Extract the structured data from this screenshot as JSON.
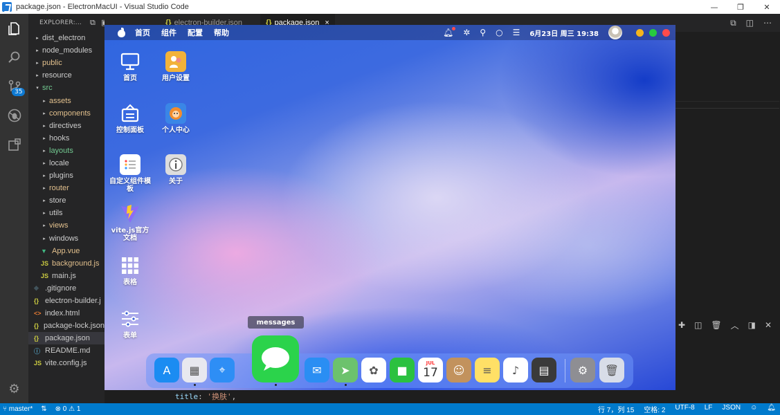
{
  "window": {
    "title": "package.json - ElectronMacUI - Visual Studio Code",
    "controls": [
      "—",
      "❐",
      "✕"
    ]
  },
  "activity": {
    "scm_badge": "35"
  },
  "explorer": {
    "header": "EXPLORER:...",
    "items": [
      {
        "label": "dist_electron",
        "kind": "folder",
        "depth": 0,
        "color": "#cccccc"
      },
      {
        "label": "node_modules",
        "kind": "folder",
        "depth": 0,
        "color": "#cccccc"
      },
      {
        "label": "public",
        "kind": "folder",
        "depth": 0,
        "color": "#e2c08d"
      },
      {
        "label": "resource",
        "kind": "folder",
        "depth": 0,
        "color": "#cccccc"
      },
      {
        "label": "src",
        "kind": "folder-open",
        "depth": 0,
        "color": "#73c991"
      },
      {
        "label": "assets",
        "kind": "folder",
        "depth": 1,
        "color": "#e2c08d"
      },
      {
        "label": "components",
        "kind": "folder",
        "depth": 1,
        "color": "#e2c08d"
      },
      {
        "label": "directives",
        "kind": "folder",
        "depth": 1,
        "color": "#cccccc"
      },
      {
        "label": "hooks",
        "kind": "folder",
        "depth": 1,
        "color": "#cccccc"
      },
      {
        "label": "layouts",
        "kind": "folder",
        "depth": 1,
        "color": "#73c991"
      },
      {
        "label": "locale",
        "kind": "folder",
        "depth": 1,
        "color": "#cccccc"
      },
      {
        "label": "plugins",
        "kind": "folder",
        "depth": 1,
        "color": "#cccccc"
      },
      {
        "label": "router",
        "kind": "folder",
        "depth": 1,
        "color": "#e2c08d"
      },
      {
        "label": "store",
        "kind": "folder",
        "depth": 1,
        "color": "#cccccc"
      },
      {
        "label": "utils",
        "kind": "folder",
        "depth": 1,
        "color": "#cccccc"
      },
      {
        "label": "views",
        "kind": "folder",
        "depth": 1,
        "color": "#e2c08d"
      },
      {
        "label": "windows",
        "kind": "folder",
        "depth": 1,
        "color": "#cccccc"
      },
      {
        "label": "App.vue",
        "kind": "vue",
        "depth": 1,
        "color": "#e2c08d"
      },
      {
        "label": "background.js",
        "kind": "js",
        "depth": 1,
        "color": "#e2c08d"
      },
      {
        "label": "main.js",
        "kind": "js",
        "depth": 1,
        "color": "#cccccc"
      },
      {
        "label": ".gitignore",
        "kind": "git",
        "depth": 0,
        "color": "#cccccc"
      },
      {
        "label": "electron-builder.j",
        "kind": "json",
        "depth": 0,
        "color": "#cccccc"
      },
      {
        "label": "index.html",
        "kind": "html",
        "depth": 0,
        "color": "#cccccc"
      },
      {
        "label": "package-lock.json",
        "kind": "json",
        "depth": 0,
        "color": "#cccccc"
      },
      {
        "label": "package.json",
        "kind": "json",
        "depth": 0,
        "color": "#cccccc",
        "selected": true
      },
      {
        "label": "README.md",
        "kind": "info",
        "depth": 0,
        "color": "#cccccc"
      },
      {
        "label": "vite.config.js",
        "kind": "js",
        "depth": 0,
        "color": "#cccccc"
      }
    ]
  },
  "tabs": [
    {
      "label": "electron-builder.json",
      "active": false
    },
    {
      "label": "package.json",
      "active": true,
      "close": "×"
    }
  ],
  "code": {
    "key": "title",
    "value": "'换肤'"
  },
  "statusbar": {
    "branch": "master*",
    "sync": "⇅",
    "errors": "0",
    "warnings": "1",
    "position": "行 7，列 15",
    "indent": "空格: 2",
    "encoding": "UTF-8",
    "eol": "LF",
    "language": "JSON"
  },
  "mac": {
    "menus": [
      "首页",
      "组件",
      "配置",
      "帮助"
    ],
    "clock": "6月23日 周三 19:38",
    "traffic_colors": [
      "#f5b51c",
      "#27c93f",
      "#ff4b4b"
    ],
    "desktop_icons": [
      {
        "label": "首页",
        "icon": "monitor-icon"
      },
      {
        "label": "用户设置",
        "icon": "user-settings-icon"
      },
      {
        "label": "控制面板",
        "icon": "control-panel-icon"
      },
      {
        "label": "个人中心",
        "icon": "personal-center-icon"
      },
      {
        "label": "自定义组件模板",
        "icon": "custom-template-icon"
      },
      {
        "label": "关于",
        "icon": "about-icon"
      },
      {
        "label": "vite.js官方文档",
        "icon": "vite-logo-icon"
      },
      {
        "label": "表格",
        "icon": "grid-icon"
      },
      {
        "label": "表单",
        "icon": "sliders-icon"
      }
    ],
    "tooltip": "messages",
    "dock_apps": [
      {
        "name": "app-store-icon",
        "glyph": "A",
        "color": "#1b8cf2",
        "running": false
      },
      {
        "name": "launchpad-icon",
        "glyph": "▦",
        "color": "#e8e8ef",
        "running": true
      },
      {
        "name": "safari-icon",
        "glyph": "⌖",
        "color": "#2e8ef5",
        "running": false
      },
      {
        "name": "messages-icon",
        "glyph": "",
        "color": "#2bd34b",
        "running": true
      },
      {
        "name": "mail-icon",
        "glyph": "✉",
        "color": "#2a8ef3",
        "running": false
      },
      {
        "name": "maps-icon",
        "glyph": "➤",
        "color": "#6cc26d",
        "running": true
      },
      {
        "name": "photos-icon",
        "glyph": "✿",
        "color": "#ffffff",
        "running": false
      },
      {
        "name": "facetime-icon",
        "glyph": "■",
        "color": "#2bc140",
        "running": false
      },
      {
        "name": "calendar-icon",
        "glyph": "17",
        "color": "#ffffff",
        "running": false
      },
      {
        "name": "contacts-icon",
        "glyph": "☺",
        "color": "#c2925d",
        "running": false
      },
      {
        "name": "notes-icon",
        "glyph": "≡",
        "color": "#ffe066",
        "running": false
      },
      {
        "name": "music-icon",
        "glyph": "♪",
        "color": "#ffffff",
        "running": false
      },
      {
        "name": "calculator-icon",
        "glyph": "▤",
        "color": "#3a3a3a",
        "running": false
      },
      {
        "name": "system-preferences-icon",
        "glyph": "⚙",
        "color": "#8e8e93",
        "running": false
      },
      {
        "name": "trash-icon",
        "glyph": "🗑",
        "color": "#d8dde8",
        "running": false
      }
    ],
    "calendar_month": "JUL"
  }
}
